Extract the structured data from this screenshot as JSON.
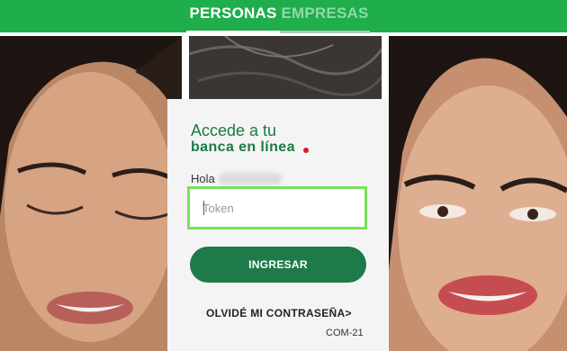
{
  "nav": {
    "tabs": [
      {
        "label": "PERSONAS",
        "active": true
      },
      {
        "label": "EMPRESAS",
        "active": false
      }
    ]
  },
  "login": {
    "title_line1": "Accede a tu",
    "title_line2": "banca en línea",
    "greeting": "Hola",
    "token_placeholder": "Token",
    "submit_label": "INGRESAR",
    "forgot_label": "OLVIDÉ MI CONTRASEÑA>",
    "code": "COM-21"
  },
  "colors": {
    "brand_green": "#1fae4b",
    "button_green": "#1e7a49",
    "input_focus": "#76e25a",
    "accent_dot": "#d11f2b"
  }
}
